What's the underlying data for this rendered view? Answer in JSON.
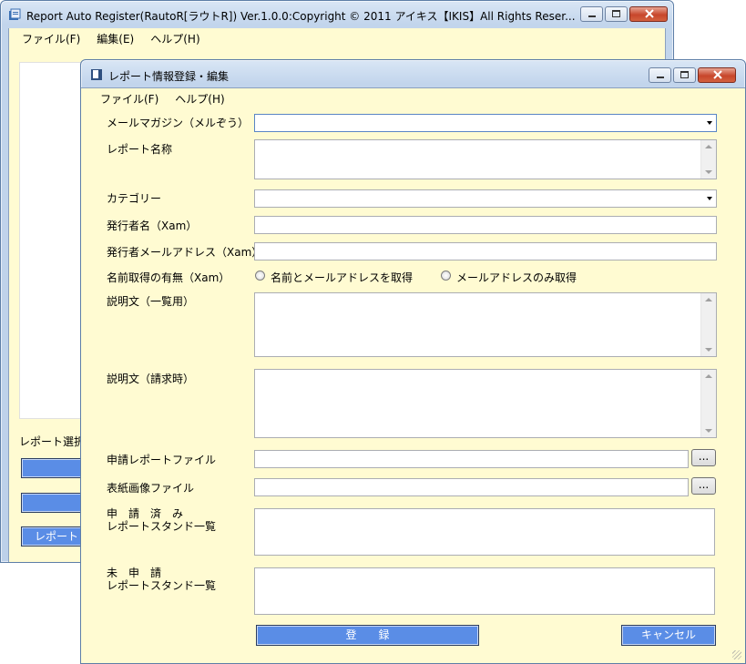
{
  "main_window": {
    "title": "Report Auto Register(RautoR[ラウトR])  Ver.1.0.0:Copyright © 2011 アイキス【IKIS】All Rights Reser...",
    "menu": [
      "ファイル(F)",
      "編集(E)",
      "ヘルプ(H)"
    ],
    "report_select_label": "レポート選択",
    "button_label_partial": "レポートリ"
  },
  "dialog": {
    "title": "レポート情報登録・編集",
    "menu": [
      "ファイル(F)",
      "ヘルプ(H)"
    ],
    "labels": {
      "mailmag": "メールマガジン（メルぞう）",
      "report_name": "レポート名称",
      "category": "カテゴリー",
      "publisher_name": "発行者名（Xam）",
      "publisher_email": "発行者メールアドレス（Xam）",
      "name_acquisition": "名前取得の有無（Xam）",
      "desc_list": "説明文（一覧用）",
      "desc_request": "説明文（請求時）",
      "apply_report_file": "申請レポートファイル",
      "cover_image_file": "表紙画像ファイル",
      "applied_line1": "申　請　済　み",
      "applied_line2": "レポートスタンド一覧",
      "unapplied_line1": "未　申　請",
      "unapplied_line2": "レポートスタンド一覧"
    },
    "radio_options": [
      "名前とメールアドレスを取得",
      "メールアドレスのみ取得"
    ],
    "browse_label": "...",
    "register_button": "登　　録",
    "cancel_button": "キャンセル"
  },
  "colors": {
    "client_bg": "#fffbd2",
    "button_blue": "#5a8de6"
  }
}
